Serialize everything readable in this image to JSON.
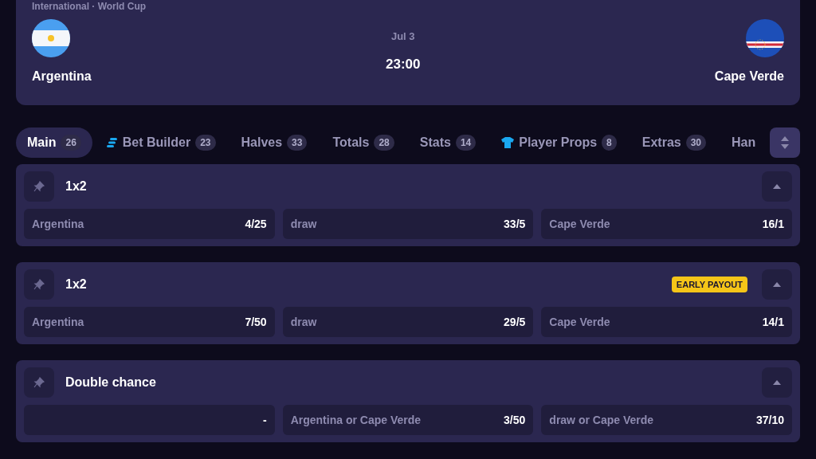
{
  "match": {
    "competition": "International · World Cup",
    "date": "Jul 3",
    "time": "23:00",
    "home": {
      "name": "Argentina"
    },
    "away": {
      "name": "Cape Verde"
    }
  },
  "tabs": [
    {
      "label": "Main",
      "count": "26",
      "kind": "plain",
      "selected": true
    },
    {
      "label": "Bet Builder",
      "count": "23",
      "kind": "builder",
      "selected": false
    },
    {
      "label": "Halves",
      "count": "33",
      "kind": "plain",
      "selected": false
    },
    {
      "label": "Totals",
      "count": "28",
      "kind": "plain",
      "selected": false
    },
    {
      "label": "Stats",
      "count": "14",
      "kind": "plain",
      "selected": false
    },
    {
      "label": "Player Props",
      "count": "8",
      "kind": "shirt",
      "selected": false
    },
    {
      "label": "Extras",
      "count": "30",
      "kind": "plain",
      "selected": false
    },
    {
      "label": "Han",
      "kind": "plain",
      "selected": false
    }
  ],
  "markets": [
    {
      "title": "1x2",
      "selections": [
        {
          "label": "Argentina",
          "odds": "4/25"
        },
        {
          "label": "draw",
          "odds": "33/5"
        },
        {
          "label": "Cape Verde",
          "odds": "16/1"
        }
      ]
    },
    {
      "title": "1x2",
      "badge": "EARLY PAYOUT",
      "selections": [
        {
          "label": "Argentina",
          "odds": "7/50"
        },
        {
          "label": "draw",
          "odds": "29/5"
        },
        {
          "label": "Cape Verde",
          "odds": "14/1"
        }
      ]
    },
    {
      "title": "Double chance",
      "selections": [
        {
          "odds": "-"
        },
        {
          "label": "Argentina or Cape Verde",
          "odds": "3/50"
        },
        {
          "label": "draw or Cape Verde",
          "odds": "37/10"
        }
      ]
    }
  ]
}
